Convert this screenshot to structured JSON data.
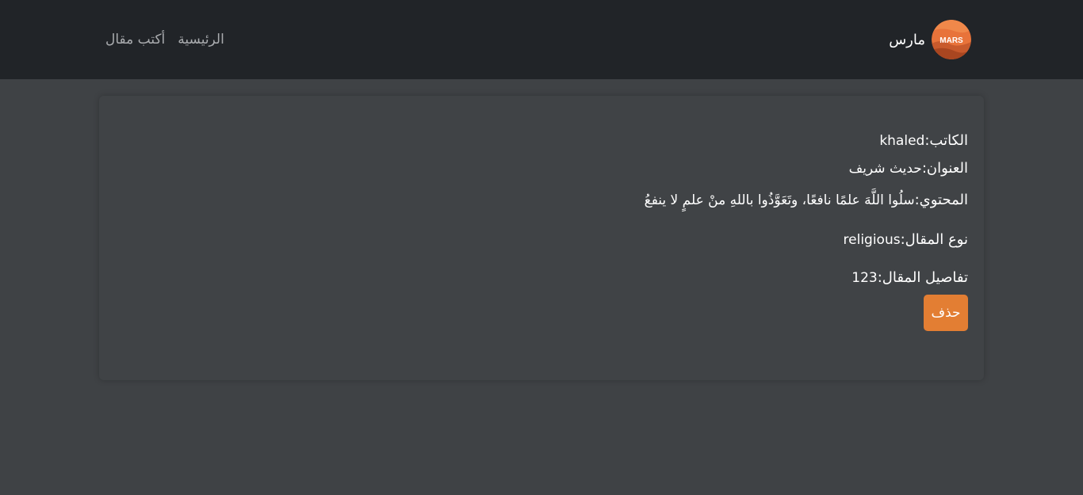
{
  "navbar": {
    "brand_name": "مارس",
    "logo_text": "MARS",
    "links": [
      {
        "label": "الرئيسية"
      },
      {
        "label": "أكتب مقال"
      }
    ]
  },
  "article": {
    "author_label": "الكاتب:",
    "author_value": "khaled",
    "title_label": "العنوان:",
    "title_value": "حديث شريف",
    "content_label": "المحتوي: ",
    "content_value": "سلُوا اللَّهَ علمًا نافعًا، وتَعَوَّذُوا باللهِ منْ علمٍ لا ينفعُ",
    "type_label": "نوع المقال:",
    "type_value": "religious",
    "details_label": "تفاصيل المقال: ",
    "details_value": "123",
    "delete_label": "حذف"
  },
  "colors": {
    "navbar_bg": "#212428",
    "page_bg": "#3f4245",
    "card_bg": "#404346",
    "accent": "#e37e33",
    "link": "#a9abae"
  }
}
